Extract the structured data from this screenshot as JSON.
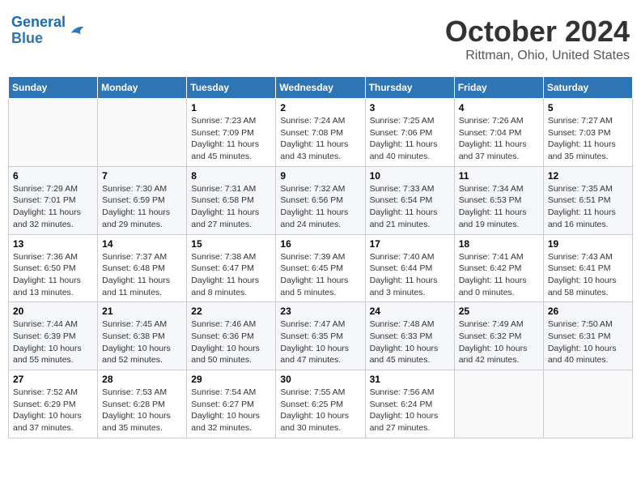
{
  "header": {
    "logo_line1": "General",
    "logo_line2": "Blue",
    "title": "October 2024",
    "location": "Rittman, Ohio, United States"
  },
  "columns": [
    "Sunday",
    "Monday",
    "Tuesday",
    "Wednesday",
    "Thursday",
    "Friday",
    "Saturday"
  ],
  "weeks": [
    [
      {
        "day": "",
        "info": ""
      },
      {
        "day": "",
        "info": ""
      },
      {
        "day": "1",
        "info": "Sunrise: 7:23 AM\nSunset: 7:09 PM\nDaylight: 11 hours and 45 minutes."
      },
      {
        "day": "2",
        "info": "Sunrise: 7:24 AM\nSunset: 7:08 PM\nDaylight: 11 hours and 43 minutes."
      },
      {
        "day": "3",
        "info": "Sunrise: 7:25 AM\nSunset: 7:06 PM\nDaylight: 11 hours and 40 minutes."
      },
      {
        "day": "4",
        "info": "Sunrise: 7:26 AM\nSunset: 7:04 PM\nDaylight: 11 hours and 37 minutes."
      },
      {
        "day": "5",
        "info": "Sunrise: 7:27 AM\nSunset: 7:03 PM\nDaylight: 11 hours and 35 minutes."
      }
    ],
    [
      {
        "day": "6",
        "info": "Sunrise: 7:29 AM\nSunset: 7:01 PM\nDaylight: 11 hours and 32 minutes."
      },
      {
        "day": "7",
        "info": "Sunrise: 7:30 AM\nSunset: 6:59 PM\nDaylight: 11 hours and 29 minutes."
      },
      {
        "day": "8",
        "info": "Sunrise: 7:31 AM\nSunset: 6:58 PM\nDaylight: 11 hours and 27 minutes."
      },
      {
        "day": "9",
        "info": "Sunrise: 7:32 AM\nSunset: 6:56 PM\nDaylight: 11 hours and 24 minutes."
      },
      {
        "day": "10",
        "info": "Sunrise: 7:33 AM\nSunset: 6:54 PM\nDaylight: 11 hours and 21 minutes."
      },
      {
        "day": "11",
        "info": "Sunrise: 7:34 AM\nSunset: 6:53 PM\nDaylight: 11 hours and 19 minutes."
      },
      {
        "day": "12",
        "info": "Sunrise: 7:35 AM\nSunset: 6:51 PM\nDaylight: 11 hours and 16 minutes."
      }
    ],
    [
      {
        "day": "13",
        "info": "Sunrise: 7:36 AM\nSunset: 6:50 PM\nDaylight: 11 hours and 13 minutes."
      },
      {
        "day": "14",
        "info": "Sunrise: 7:37 AM\nSunset: 6:48 PM\nDaylight: 11 hours and 11 minutes."
      },
      {
        "day": "15",
        "info": "Sunrise: 7:38 AM\nSunset: 6:47 PM\nDaylight: 11 hours and 8 minutes."
      },
      {
        "day": "16",
        "info": "Sunrise: 7:39 AM\nSunset: 6:45 PM\nDaylight: 11 hours and 5 minutes."
      },
      {
        "day": "17",
        "info": "Sunrise: 7:40 AM\nSunset: 6:44 PM\nDaylight: 11 hours and 3 minutes."
      },
      {
        "day": "18",
        "info": "Sunrise: 7:41 AM\nSunset: 6:42 PM\nDaylight: 11 hours and 0 minutes."
      },
      {
        "day": "19",
        "info": "Sunrise: 7:43 AM\nSunset: 6:41 PM\nDaylight: 10 hours and 58 minutes."
      }
    ],
    [
      {
        "day": "20",
        "info": "Sunrise: 7:44 AM\nSunset: 6:39 PM\nDaylight: 10 hours and 55 minutes."
      },
      {
        "day": "21",
        "info": "Sunrise: 7:45 AM\nSunset: 6:38 PM\nDaylight: 10 hours and 52 minutes."
      },
      {
        "day": "22",
        "info": "Sunrise: 7:46 AM\nSunset: 6:36 PM\nDaylight: 10 hours and 50 minutes."
      },
      {
        "day": "23",
        "info": "Sunrise: 7:47 AM\nSunset: 6:35 PM\nDaylight: 10 hours and 47 minutes."
      },
      {
        "day": "24",
        "info": "Sunrise: 7:48 AM\nSunset: 6:33 PM\nDaylight: 10 hours and 45 minutes."
      },
      {
        "day": "25",
        "info": "Sunrise: 7:49 AM\nSunset: 6:32 PM\nDaylight: 10 hours and 42 minutes."
      },
      {
        "day": "26",
        "info": "Sunrise: 7:50 AM\nSunset: 6:31 PM\nDaylight: 10 hours and 40 minutes."
      }
    ],
    [
      {
        "day": "27",
        "info": "Sunrise: 7:52 AM\nSunset: 6:29 PM\nDaylight: 10 hours and 37 minutes."
      },
      {
        "day": "28",
        "info": "Sunrise: 7:53 AM\nSunset: 6:28 PM\nDaylight: 10 hours and 35 minutes."
      },
      {
        "day": "29",
        "info": "Sunrise: 7:54 AM\nSunset: 6:27 PM\nDaylight: 10 hours and 32 minutes."
      },
      {
        "day": "30",
        "info": "Sunrise: 7:55 AM\nSunset: 6:25 PM\nDaylight: 10 hours and 30 minutes."
      },
      {
        "day": "31",
        "info": "Sunrise: 7:56 AM\nSunset: 6:24 PM\nDaylight: 10 hours and 27 minutes."
      },
      {
        "day": "",
        "info": ""
      },
      {
        "day": "",
        "info": ""
      }
    ]
  ]
}
